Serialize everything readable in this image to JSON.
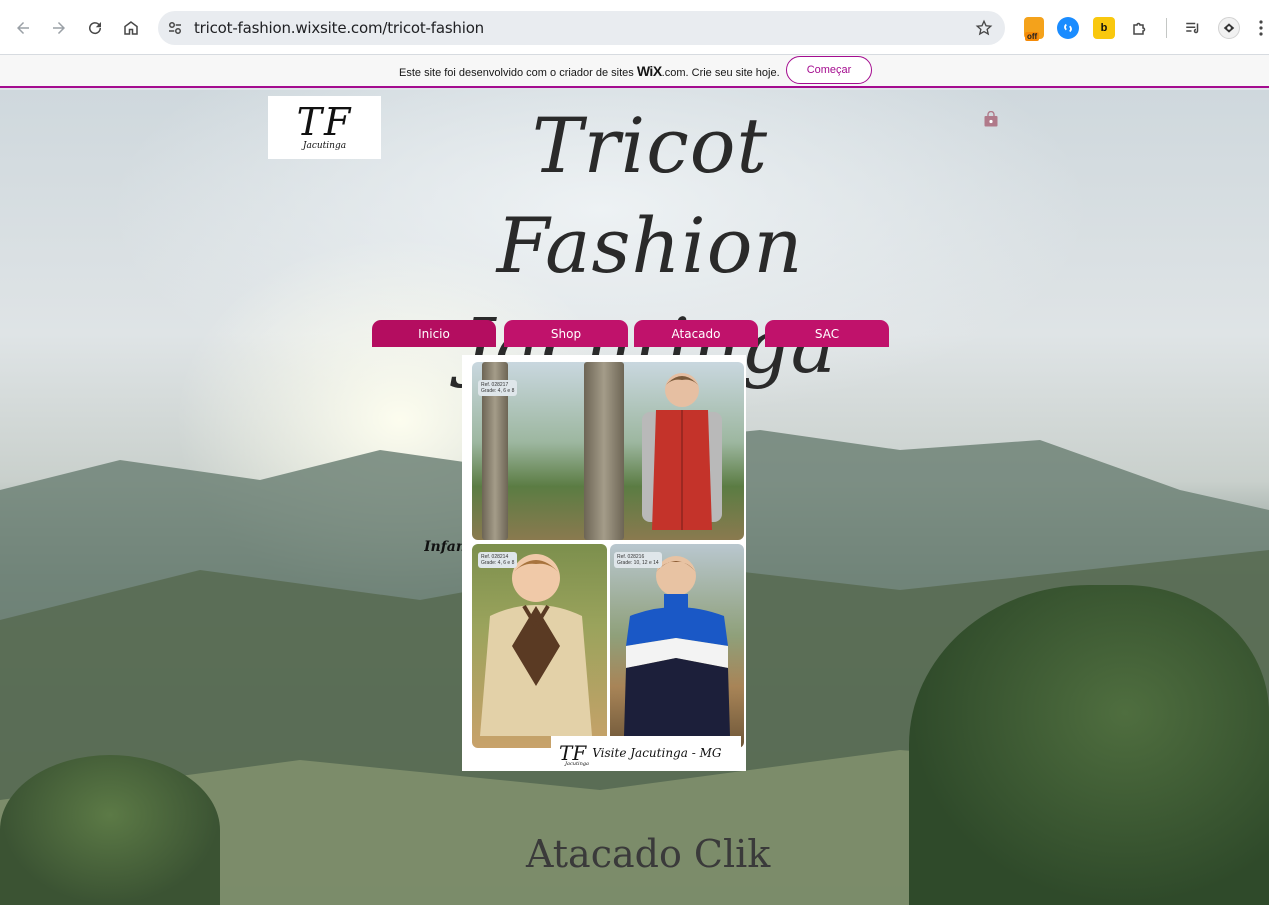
{
  "browser": {
    "url": "tricot-fashion.wixsite.com/tricot-fashion",
    "extensions": [
      {
        "name": "coupon-extension-icon",
        "badge": "off"
      },
      {
        "name": "shazam-extension-icon"
      },
      {
        "name": "b-extension-icon",
        "label": "b"
      },
      {
        "name": "puzzle-icon"
      },
      {
        "name": "media-control-icon"
      },
      {
        "name": "profile-avatar"
      },
      {
        "name": "more-menu-icon"
      }
    ]
  },
  "wix_banner": {
    "text_before": "Este site foi desenvolvido com o criador de sites ",
    "logo": "WiX",
    "text_after": ".com. Crie seu site hoje.",
    "button": "Começar",
    "accent": "#a40c8f"
  },
  "site": {
    "logo_mark": "TF",
    "logo_sub": "Jacutinga",
    "title_line1": "Tricot Fashion",
    "title_line2": "Jacutinga M.G",
    "menu": [
      {
        "label": "Inicio",
        "active": true
      },
      {
        "label": "Shop",
        "active": false
      },
      {
        "label": "Atacado",
        "active": false
      },
      {
        "label": "SAC",
        "active": false
      }
    ],
    "menu_color": "#c0126b",
    "side_label": "Infantil",
    "collage": {
      "tag1_ref": "Ref. 028217",
      "tag1_grade": "Grade: 4, 6 e 8",
      "tag2_ref": "Ref. 028214",
      "tag2_grade": "Grade: 4, 6 e 8",
      "tag3_ref": "Ref. 028216",
      "tag3_grade": "Grade: 10, 12 e 14",
      "caption_logo": "TF",
      "caption_text": "Visite Jacutinga - MG",
      "caption_sub": "Jacutinga"
    },
    "bottom_text": "Atacado Clik"
  }
}
